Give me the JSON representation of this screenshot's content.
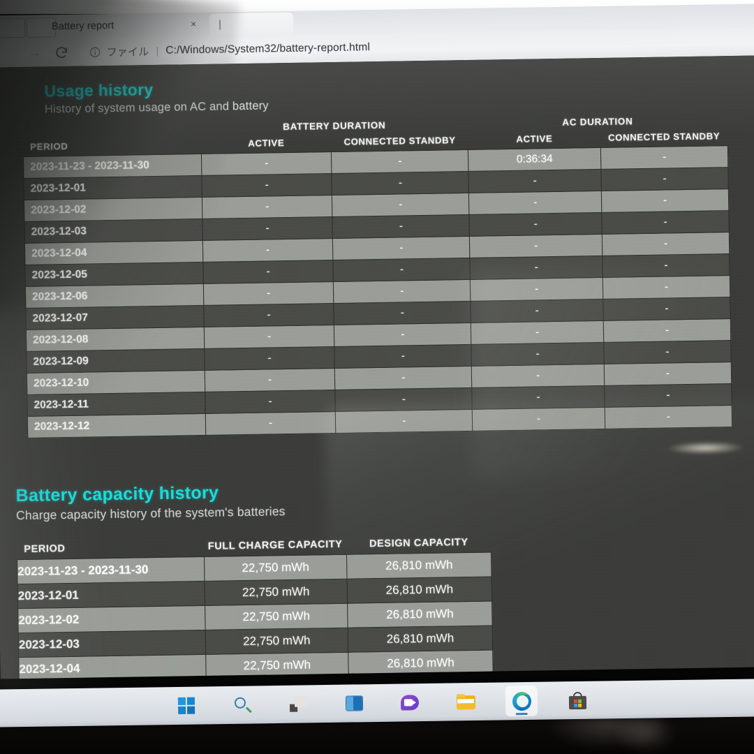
{
  "browser": {
    "tab_title": "Battery report",
    "tab_close_glyph": "×",
    "back_arrow_glyph": "→",
    "reload_glyph": "⟳",
    "info_glyph": "ⓘ",
    "file_label": "ファイル",
    "separator": "|",
    "url": "C:/Windows/System32/battery-report.html"
  },
  "usage_history": {
    "title": "Usage history",
    "subtitle": "History of system usage on AC and battery",
    "group_headers": [
      "",
      "BATTERY DURATION",
      "AC DURATION"
    ],
    "columns": [
      "PERIOD",
      "ACTIVE",
      "CONNECTED STANDBY",
      "ACTIVE",
      "CONNECTED STANDBY"
    ],
    "rows": [
      {
        "period": "2023-11-23 - 2023-11-30",
        "battery_active": "-",
        "battery_standby": "-",
        "ac_active": "0:36:34",
        "ac_standby": "-"
      },
      {
        "period": "2023-12-01",
        "battery_active": "-",
        "battery_standby": "-",
        "ac_active": "-",
        "ac_standby": "-"
      },
      {
        "period": "2023-12-02",
        "battery_active": "-",
        "battery_standby": "-",
        "ac_active": "-",
        "ac_standby": "-"
      },
      {
        "period": "2023-12-03",
        "battery_active": "-",
        "battery_standby": "-",
        "ac_active": "-",
        "ac_standby": "-"
      },
      {
        "period": "2023-12-04",
        "battery_active": "-",
        "battery_standby": "-",
        "ac_active": "-",
        "ac_standby": "-"
      },
      {
        "period": "2023-12-05",
        "battery_active": "-",
        "battery_standby": "-",
        "ac_active": "-",
        "ac_standby": "-"
      },
      {
        "period": "2023-12-06",
        "battery_active": "-",
        "battery_standby": "-",
        "ac_active": "-",
        "ac_standby": "-"
      },
      {
        "period": "2023-12-07",
        "battery_active": "-",
        "battery_standby": "-",
        "ac_active": "-",
        "ac_standby": "-"
      },
      {
        "period": "2023-12-08",
        "battery_active": "-",
        "battery_standby": "-",
        "ac_active": "-",
        "ac_standby": "-"
      },
      {
        "period": "2023-12-09",
        "battery_active": "-",
        "battery_standby": "-",
        "ac_active": "-",
        "ac_standby": "-"
      },
      {
        "period": "2023-12-10",
        "battery_active": "-",
        "battery_standby": "-",
        "ac_active": "-",
        "ac_standby": "-"
      },
      {
        "period": "2023-12-11",
        "battery_active": "-",
        "battery_standby": "-",
        "ac_active": "-",
        "ac_standby": "-"
      },
      {
        "period": "2023-12-12",
        "battery_active": "-",
        "battery_standby": "-",
        "ac_active": "-",
        "ac_standby": "-"
      }
    ]
  },
  "battery_capacity_history": {
    "title": "Battery capacity history",
    "subtitle": "Charge capacity history of the system's batteries",
    "columns": [
      "PERIOD",
      "FULL CHARGE CAPACITY",
      "DESIGN CAPACITY"
    ],
    "rows": [
      {
        "period": "2023-11-23 - 2023-11-30",
        "full_charge_capacity": "22,750 mWh",
        "design_capacity": "26,810 mWh"
      },
      {
        "period": "2023-12-01",
        "full_charge_capacity": "22,750 mWh",
        "design_capacity": "26,810 mWh"
      },
      {
        "period": "2023-12-02",
        "full_charge_capacity": "22,750 mWh",
        "design_capacity": "26,810 mWh"
      },
      {
        "period": "2023-12-03",
        "full_charge_capacity": "22,750 mWh",
        "design_capacity": "26,810 mWh"
      },
      {
        "period": "2023-12-04",
        "full_charge_capacity": "22,750 mWh",
        "design_capacity": "26,810 mWh"
      }
    ]
  },
  "taskbar": {
    "items": [
      {
        "name": "start-button",
        "label": "Start"
      },
      {
        "name": "search-button",
        "label": "Search"
      },
      {
        "name": "task-view-button",
        "label": "Task View"
      },
      {
        "name": "widgets-button",
        "label": "Widgets"
      },
      {
        "name": "chat-button",
        "label": "Chat"
      },
      {
        "name": "file-explorer-button",
        "label": "File Explorer"
      },
      {
        "name": "edge-button",
        "label": "Microsoft Edge"
      },
      {
        "name": "microsoft-store-button",
        "label": "Microsoft Store"
      }
    ]
  },
  "colors": {
    "heading_cyan": "#16dede",
    "page_background": "#3b3c39",
    "row_light": "#9b9e98",
    "row_dark": "#4a4b47",
    "taskbar": "#e0e4e8"
  }
}
